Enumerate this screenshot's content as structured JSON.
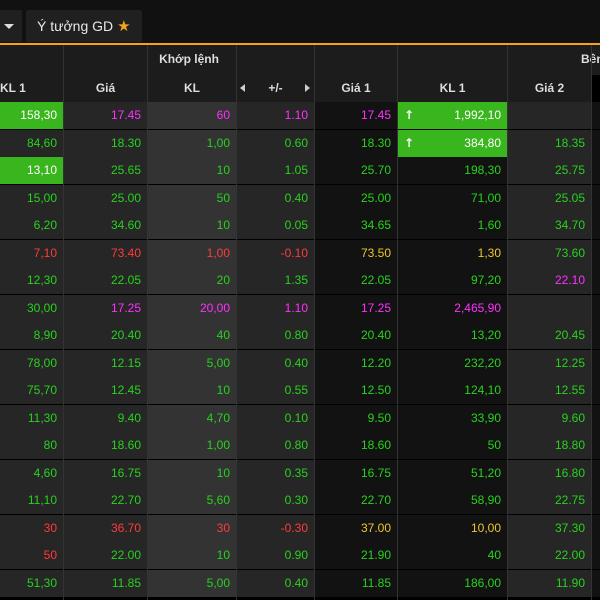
{
  "tabs": {
    "idea_label": "Ý tưởng GD",
    "idea_star": "★"
  },
  "section": {
    "khop_lenh": "Khớp lệnh",
    "ben": "Bên"
  },
  "columns": {
    "kl1_left": "KL 1",
    "gia": "Giá",
    "kl": "KL",
    "change": "+/-",
    "gia1": "Giá 1",
    "kl1": "KL 1",
    "gia2": "Giá 2"
  },
  "colors": {
    "up": "#28d21e",
    "ceiling": "#ff30ff",
    "down": "#ff3b3b",
    "ref": "#f0c62a",
    "highlight": "#39b51e",
    "accent": "#f7a21b"
  },
  "rows": [
    {
      "kl1l": "158,30",
      "gia": "17.45",
      "kl": "60",
      "ch": "1.10",
      "g1": "17.45",
      "k1": "1,992,10",
      "g2": "",
      "c": {
        "gia": "m",
        "kl": "m",
        "ch": "m",
        "g1": "m",
        "k1": "hl",
        "g2": "g"
      },
      "kl1l_hl": true,
      "up": true
    },
    {
      "kl1l": "84,60",
      "gia": "18.30",
      "kl": "1,00",
      "ch": "0.60",
      "g1": "18.30",
      "k1": "384,80",
      "g2": "18.35",
      "c": {
        "gia": "g",
        "kl": "g",
        "ch": "g",
        "g1": "g",
        "k1": "hl",
        "g2": "g"
      },
      "up": true
    },
    {
      "kl1l": "13,10",
      "gia": "25.65",
      "kl": "10",
      "ch": "1.05",
      "g1": "25.70",
      "k1": "198,30",
      "g2": "25.75",
      "c": {
        "gia": "g",
        "kl": "g",
        "ch": "g",
        "g1": "g",
        "k1": "g",
        "g2": "g"
      },
      "kl1l_hl": true
    },
    {
      "kl1l": "15,00",
      "gia": "25.00",
      "kl": "50",
      "ch": "0.40",
      "g1": "25.00",
      "k1": "71,00",
      "g2": "25.05",
      "c": {
        "gia": "g",
        "kl": "g",
        "ch": "g",
        "g1": "g",
        "k1": "g",
        "g2": "g"
      }
    },
    {
      "kl1l": "6,20",
      "gia": "34.60",
      "kl": "10",
      "ch": "0.05",
      "g1": "34.65",
      "k1": "1,60",
      "g2": "34.70",
      "c": {
        "gia": "g",
        "kl": "g",
        "ch": "g",
        "g1": "g",
        "k1": "g",
        "g2": "g"
      }
    },
    {
      "kl1l": "7,10",
      "gia": "73.40",
      "kl": "1,00",
      "ch": "-0.10",
      "g1": "73.50",
      "k1": "1,30",
      "g2": "73.60",
      "c": {
        "gia": "r",
        "kl": "r",
        "ch": "r",
        "g1": "y",
        "k1": "y",
        "g2": "g"
      },
      "kl1l_c": "r"
    },
    {
      "kl1l": "12,30",
      "gia": "22.05",
      "kl": "20",
      "ch": "1.35",
      "g1": "22.05",
      "k1": "97,20",
      "g2": "22.10",
      "c": {
        "gia": "g",
        "kl": "g",
        "ch": "g",
        "g1": "g",
        "k1": "g",
        "g2": "m"
      }
    },
    {
      "kl1l": "30,00",
      "gia": "17.25",
      "kl": "20,00",
      "ch": "1.10",
      "g1": "17.25",
      "k1": "2,465,90",
      "g2": "",
      "c": {
        "gia": "m",
        "kl": "m",
        "ch": "m",
        "g1": "m",
        "k1": "m",
        "g2": "g"
      }
    },
    {
      "kl1l": "8,90",
      "gia": "20.40",
      "kl": "40",
      "ch": "0.80",
      "g1": "20.40",
      "k1": "13,20",
      "g2": "20.45",
      "c": {
        "gia": "g",
        "kl": "g",
        "ch": "g",
        "g1": "g",
        "k1": "g",
        "g2": "g"
      }
    },
    {
      "kl1l": "78,00",
      "gia": "12.15",
      "kl": "5,00",
      "ch": "0.40",
      "g1": "12.20",
      "k1": "232,20",
      "g2": "12.25",
      "c": {
        "gia": "g",
        "kl": "g",
        "ch": "g",
        "g1": "g",
        "k1": "g",
        "g2": "g"
      }
    },
    {
      "kl1l": "75,70",
      "gia": "12.45",
      "kl": "10",
      "ch": "0.55",
      "g1": "12.50",
      "k1": "124,10",
      "g2": "12.55",
      "c": {
        "gia": "g",
        "kl": "g",
        "ch": "g",
        "g1": "g",
        "k1": "g",
        "g2": "g"
      }
    },
    {
      "kl1l": "11,30",
      "gia": "9.40",
      "kl": "4,70",
      "ch": "0.10",
      "g1": "9.50",
      "k1": "33,90",
      "g2": "9.60",
      "c": {
        "gia": "g",
        "kl": "g",
        "ch": "g",
        "g1": "g",
        "k1": "g",
        "g2": "g"
      }
    },
    {
      "kl1l": "80",
      "gia": "18.60",
      "kl": "1,00",
      "ch": "0.80",
      "g1": "18.60",
      "k1": "50",
      "g2": "18.80",
      "c": {
        "gia": "g",
        "kl": "g",
        "ch": "g",
        "g1": "g",
        "k1": "g",
        "g2": "g"
      }
    },
    {
      "kl1l": "4,60",
      "gia": "16.75",
      "kl": "10",
      "ch": "0.35",
      "g1": "16.75",
      "k1": "51,20",
      "g2": "16.80",
      "c": {
        "gia": "g",
        "kl": "g",
        "ch": "g",
        "g1": "g",
        "k1": "g",
        "g2": "g"
      }
    },
    {
      "kl1l": "11,10",
      "gia": "22.70",
      "kl": "5,60",
      "ch": "0.30",
      "g1": "22.70",
      "k1": "58,90",
      "g2": "22.75",
      "c": {
        "gia": "g",
        "kl": "g",
        "ch": "g",
        "g1": "g",
        "k1": "g",
        "g2": "g"
      }
    },
    {
      "kl1l": "30",
      "gia": "36.70",
      "kl": "30",
      "ch": "-0.30",
      "g1": "37.00",
      "k1": "10,00",
      "g2": "37.30",
      "c": {
        "gia": "r",
        "kl": "r",
        "ch": "r",
        "g1": "y",
        "k1": "y",
        "g2": "g"
      },
      "kl1l_c": "r"
    },
    {
      "kl1l": "50",
      "gia": "22.00",
      "kl": "10",
      "ch": "0.90",
      "g1": "21.90",
      "k1": "40",
      "g2": "22.00",
      "c": {
        "gia": "g",
        "kl": "g",
        "ch": "g",
        "g1": "g",
        "k1": "g",
        "g2": "g"
      },
      "kl1l_c": "r"
    },
    {
      "kl1l": "51,30",
      "gia": "11.85",
      "kl": "5,00",
      "ch": "0.40",
      "g1": "11.85",
      "k1": "186,00",
      "g2": "11.90",
      "c": {
        "gia": "g",
        "kl": "g",
        "ch": "g",
        "g1": "g",
        "k1": "g",
        "g2": "g"
      }
    }
  ]
}
